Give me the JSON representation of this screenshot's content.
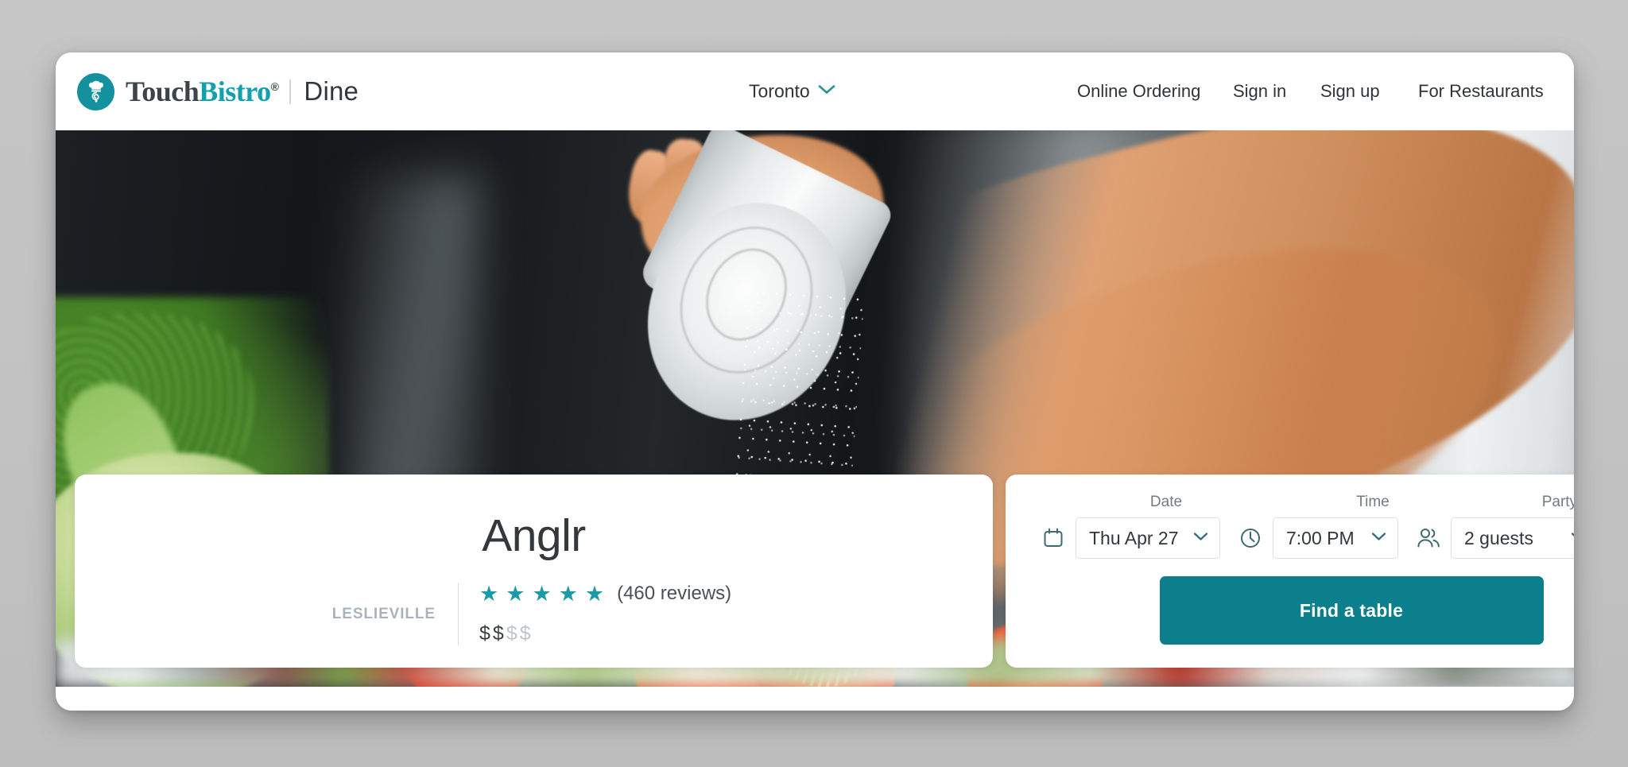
{
  "colors": {
    "brand_teal": "#11a0ad",
    "button_teal": "#0b7f8c",
    "star_teal": "#1c9aa6",
    "icon_teal": "#3f6b70",
    "page_background": "#c4c4c4",
    "text_dark": "#31373b",
    "text_muted": "#737b81",
    "neighbourhood_grey": "#a9b3bd"
  },
  "header": {
    "logo_icon": "chef-hat-circle-icon",
    "wordmark_touch": "Touch",
    "wordmark_bistro": "Bistro",
    "wordmark_registered": "®",
    "product_name": "Dine",
    "city": {
      "label": "Toronto",
      "chevron_icon": "chevron-down-icon"
    },
    "nav": [
      {
        "label": "Online Ordering"
      },
      {
        "label": "Sign in"
      },
      {
        "label": "Sign up"
      },
      {
        "label": "For Restaurants"
      }
    ]
  },
  "hero": {
    "alt": "Chef seasoning fresh tomatoes and greens with a salt shaker"
  },
  "restaurant": {
    "name": "Anglr",
    "neighbourhood": "LESLIEVILLE",
    "rating_stars_filled": 5,
    "star_glyph": "★",
    "reviews_text": "(460 reviews)",
    "review_count": 460,
    "price_level": 2,
    "price_max": 4,
    "price_glyph": "$"
  },
  "booking": {
    "date": {
      "label": "Date",
      "icon": "calendar-icon",
      "value": "Thu Apr 27",
      "chevron_icon": "chevron-down-icon"
    },
    "time": {
      "label": "Time",
      "icon": "clock-icon",
      "value": "7:00 PM",
      "chevron_icon": "chevron-down-icon"
    },
    "party": {
      "label": "Party Size",
      "icon": "people-icon",
      "value": "2 guests",
      "chevron_icon": "chevron-down-icon"
    },
    "submit_label": "Find a table"
  }
}
